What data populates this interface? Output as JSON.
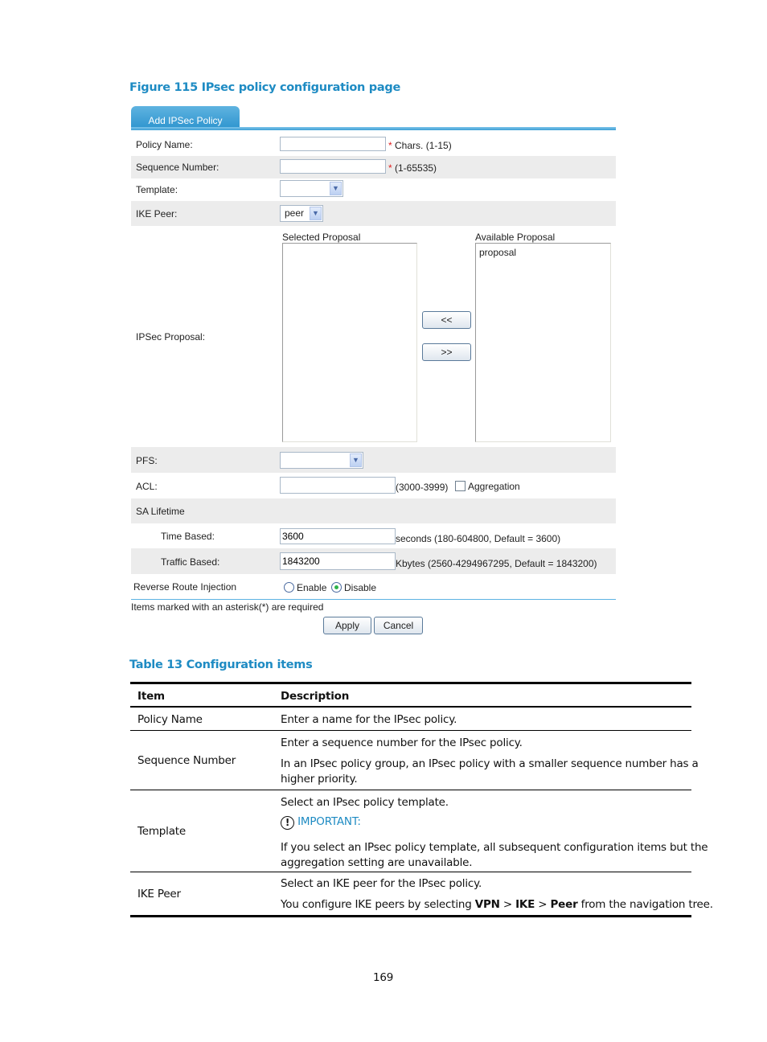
{
  "figure_caption": "Figure 115 IPsec policy configuration page",
  "form": {
    "tab_label": "Add IPSec Policy",
    "policy_name": {
      "label": "Policy Name:",
      "value": "",
      "required_mark": "*",
      "hint": "Chars. (1-15)"
    },
    "sequence_number": {
      "label": "Sequence Number:",
      "value": "",
      "required_mark": "*",
      "hint": "(1-65535)"
    },
    "template": {
      "label": "Template:",
      "value": ""
    },
    "ike_peer": {
      "label": "IKE Peer:",
      "value": "peer"
    },
    "ipsec_proposal": {
      "label": "IPSec Proposal:",
      "selected_label": "Selected Proposal",
      "selected_items": [],
      "available_label": "Available Proposal",
      "available_items": [
        "proposal"
      ],
      "add_button": "<<",
      "remove_button": ">>"
    },
    "pfs": {
      "label": "PFS:",
      "value": ""
    },
    "acl": {
      "label": "ACL:",
      "value": "",
      "hint": "(3000-3999)",
      "aggregation_label": "Aggregation",
      "aggregation_checked": false
    },
    "sa_lifetime": {
      "label": "SA Lifetime"
    },
    "time_based": {
      "label": "Time Based:",
      "value": "3600",
      "hint": "seconds (180-604800, Default = 3600)"
    },
    "traffic_based": {
      "label": "Traffic Based:",
      "value": "1843200",
      "hint": "Kbytes (2560-4294967295, Default = 1843200)"
    },
    "reverse_route_injection": {
      "label": "Reverse Route Injection",
      "options": [
        "Enable",
        "Disable"
      ],
      "selected": "Disable"
    },
    "required_note": "Items marked with an asterisk(*) are required",
    "apply_button": "Apply",
    "cancel_button": "Cancel"
  },
  "table_caption": "Table 13 Configuration items",
  "table": {
    "headers": [
      "Item",
      "Description"
    ],
    "rows": [
      {
        "item": "Policy Name",
        "desc": [
          "Enter a name for the IPsec policy."
        ]
      },
      {
        "item": "Sequence Number",
        "desc": [
          "Enter a sequence number for the IPsec policy.",
          "In an IPsec policy group, an IPsec policy with a smaller sequence number has a",
          "higher priority."
        ]
      },
      {
        "item": "Template",
        "desc": [
          "Select an IPsec policy template.",
          "IMPORTANT:",
          "If you select an IPsec policy template, all subsequent configuration items but the",
          "aggregation setting are unavailable."
        ]
      },
      {
        "item": "IKE Peer",
        "desc": [
          "Select an IKE peer for the IPsec policy.",
          "You configure IKE peers by selecting ",
          "VPN",
          " > ",
          "IKE",
          " > ",
          "Peer",
          " from the navigation tree."
        ]
      }
    ]
  },
  "page_number": "169"
}
